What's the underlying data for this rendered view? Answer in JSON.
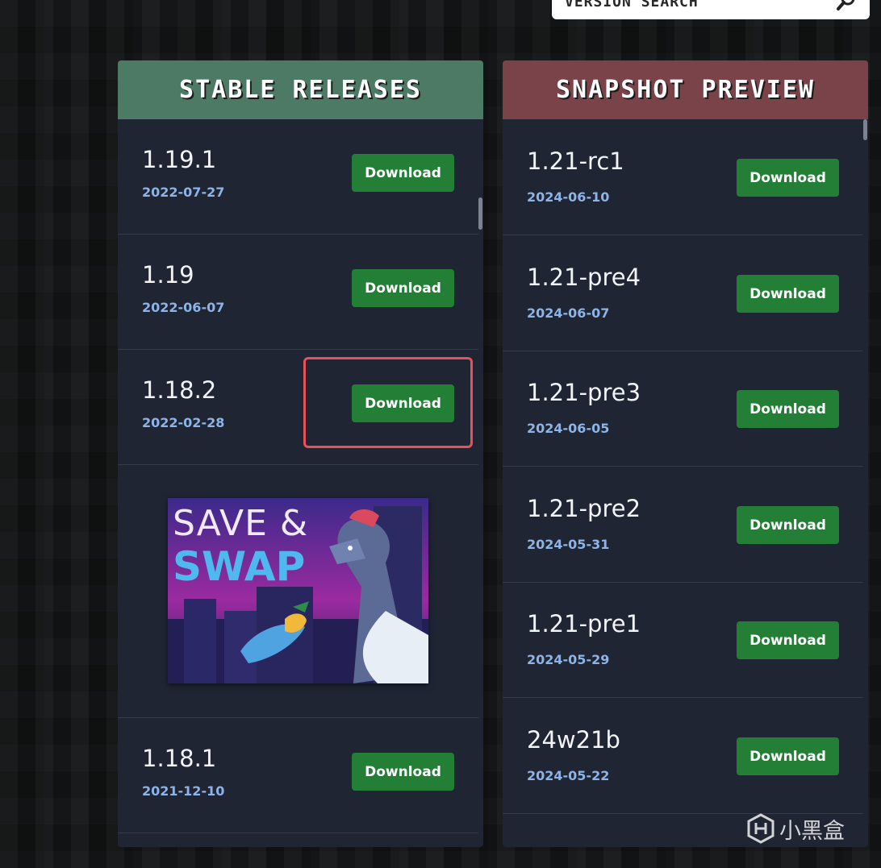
{
  "search": {
    "label": "VERSION SEARCH"
  },
  "stable": {
    "title": "STABLE RELEASES",
    "items": [
      {
        "version": "1.19.1",
        "date": "2022-07-27",
        "button": "Download"
      },
      {
        "version": "1.19",
        "date": "2022-06-07",
        "button": "Download"
      },
      {
        "version": "1.18.2",
        "date": "2022-02-28",
        "button": "Download"
      },
      {
        "version": "1.18.1",
        "date": "2021-12-10",
        "button": "Download"
      }
    ],
    "ad": {
      "line1": "SAVE &",
      "line2": "SWAP"
    }
  },
  "snapshot": {
    "title": "SNAPSHOT PREVIEW",
    "items": [
      {
        "version": "1.21-rc1",
        "date": "2024-06-10",
        "button": "Download"
      },
      {
        "version": "1.21-pre4",
        "date": "2024-06-07",
        "button": "Download"
      },
      {
        "version": "1.21-pre3",
        "date": "2024-06-05",
        "button": "Download"
      },
      {
        "version": "1.21-pre2",
        "date": "2024-05-31",
        "button": "Download"
      },
      {
        "version": "1.21-pre1",
        "date": "2024-05-29",
        "button": "Download"
      },
      {
        "version": "24w21b",
        "date": "2024-05-22",
        "button": "Download"
      }
    ]
  },
  "watermark": {
    "text": "小黑盒"
  },
  "colors": {
    "stable_header": "#4d7a64",
    "snapshot_header": "#7a4249",
    "download_button": "#247f36",
    "date_text": "#8eb3e6",
    "highlight": "#e8505b"
  }
}
